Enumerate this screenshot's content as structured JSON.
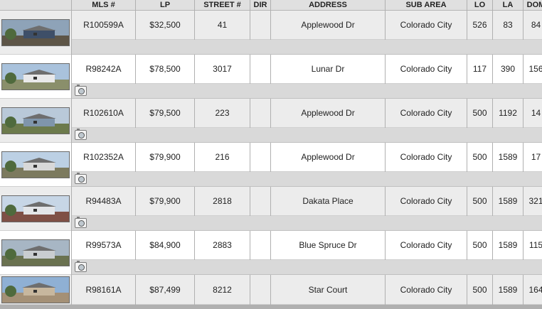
{
  "columns": [
    "",
    "MLS #",
    "LP",
    "STREET #",
    "DIR",
    "ADDRESS",
    "SUB AREA",
    "LO",
    "LA",
    "DOM"
  ],
  "listings": [
    {
      "mls": "R100599A",
      "lp": "$32,500",
      "street_num": "41",
      "dir": "",
      "address": "Applewood Dr",
      "sub_area": "Colorado City",
      "lo": "526",
      "la": "83",
      "dom": "84",
      "has_photo_icon": false
    },
    {
      "mls": "R98242A",
      "lp": "$78,500",
      "street_num": "3017",
      "dir": "",
      "address": "Lunar Dr",
      "sub_area": "Colorado City",
      "lo": "117",
      "la": "390",
      "dom": "156",
      "has_photo_icon": true
    },
    {
      "mls": "R102610A",
      "lp": "$79,500",
      "street_num": "223",
      "dir": "",
      "address": "Applewood Dr",
      "sub_area": "Colorado City",
      "lo": "500",
      "la": "1192",
      "dom": "14",
      "has_photo_icon": true
    },
    {
      "mls": "R102352A",
      "lp": "$79,900",
      "street_num": "216",
      "dir": "",
      "address": "Applewood Dr",
      "sub_area": "Colorado City",
      "lo": "500",
      "la": "1589",
      "dom": "17",
      "has_photo_icon": true
    },
    {
      "mls": "R94483A",
      "lp": "$79,900",
      "street_num": "2818",
      "dir": "",
      "address": "Dakata Place",
      "sub_area": "Colorado City",
      "lo": "500",
      "la": "1589",
      "dom": "321",
      "has_photo_icon": true
    },
    {
      "mls": "R99573A",
      "lp": "$84,900",
      "street_num": "2883",
      "dir": "",
      "address": "Blue Spruce Dr",
      "sub_area": "Colorado City",
      "lo": "500",
      "la": "1589",
      "dom": "115",
      "has_photo_icon": true
    },
    {
      "mls": "R98161A",
      "lp": "$87,499",
      "street_num": "8212",
      "dir": "",
      "address": "Star Court",
      "sub_area": "Colorado City",
      "lo": "500",
      "la": "1589",
      "dom": "164",
      "has_photo_icon": false
    }
  ],
  "icons": {
    "photo": "camera-icon"
  },
  "colors": {
    "header_bg": "#e0e0e0",
    "row_odd": "#ececec",
    "row_even": "#ffffff",
    "photo_bar": "#d9d9d9"
  }
}
